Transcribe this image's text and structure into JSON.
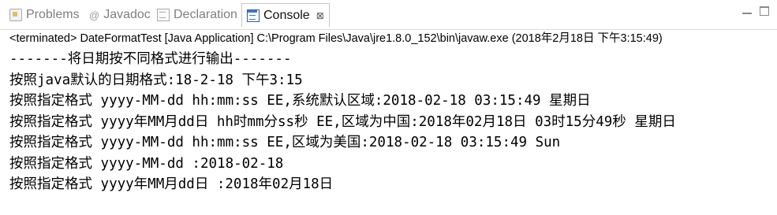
{
  "tabs": [
    {
      "label": "Problems",
      "icon": "problems-icon"
    },
    {
      "label": "Javadoc",
      "icon": "javadoc-icon"
    },
    {
      "label": "Declaration",
      "icon": "declaration-icon"
    },
    {
      "label": "Console",
      "icon": "console-icon",
      "active": true,
      "close": "⊠"
    }
  ],
  "status_text": "<terminated> DateFormatTest [Java Application] C:\\Program Files\\Java\\jre1.8.0_152\\bin\\javaw.exe (2018年2月18日 下午3:15:49)",
  "console_lines": [
    "-------将日期按不同格式进行输出-------",
    "按照java默认的日期格式:18-2-18 下午3:15",
    "按照指定格式 yyyy-MM-dd hh:mm:ss EE,系统默认区域:2018-02-18 03:15:49 星期日",
    "按照指定格式 yyyy年MM月dd日 hh时mm分ss秒 EE,区域为中国:2018年02月18日 03时15分49秒 星期日",
    "按照指定格式 yyyy-MM-dd hh:mm:ss EE,区域为美国:2018-02-18 03:15:49 Sun",
    "按照指定格式 yyyy-MM-dd :2018-02-18",
    "按照指定格式 yyyy年MM月dd日 :2018年02月18日"
  ],
  "colors": {
    "active_tab_border": "#c8c8c8",
    "console_icon": "#3d76c6"
  }
}
